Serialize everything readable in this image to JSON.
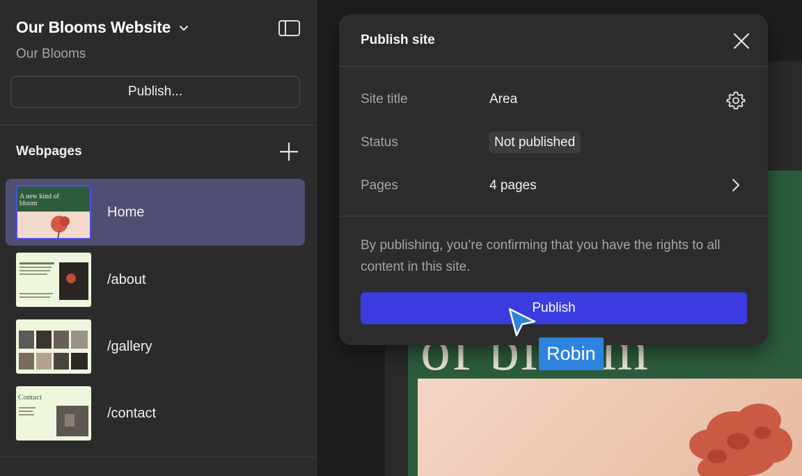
{
  "sidebar": {
    "site_name": "Our Blooms Website",
    "site_subtitle": "Our Blooms",
    "publish_button": "Publish...",
    "section_title": "Webpages",
    "pages": [
      {
        "label": "Home",
        "active": true
      },
      {
        "label": "/about",
        "active": false
      },
      {
        "label": "/gallery",
        "active": false
      },
      {
        "label": "/contact",
        "active": false
      }
    ],
    "thumbnails": {
      "home_heading": "A new kind of bloom",
      "contact_heading": "Contact"
    }
  },
  "dialog": {
    "title": "Publish site",
    "rows": {
      "site_title_label": "Site title",
      "site_title_value": "Area",
      "status_label": "Status",
      "status_value": "Not published",
      "pages_label": "Pages",
      "pages_value": "4 pages"
    },
    "note": "By publishing, you’re confirming that you have the rights to all content in this site.",
    "publish_button": "Publish"
  },
  "cursor": {
    "user_name": "Robin"
  },
  "colors": {
    "accent": "#3b3be0",
    "active_item": "#4f4f74",
    "cursor": "#2e82e0",
    "preview_green": "#2d5c3d"
  },
  "icons": [
    "chevron-down-icon",
    "sidebar-toggle-icon",
    "plus-icon",
    "close-icon",
    "gear-icon",
    "chevron-right-icon",
    "cursor-arrow-icon"
  ]
}
